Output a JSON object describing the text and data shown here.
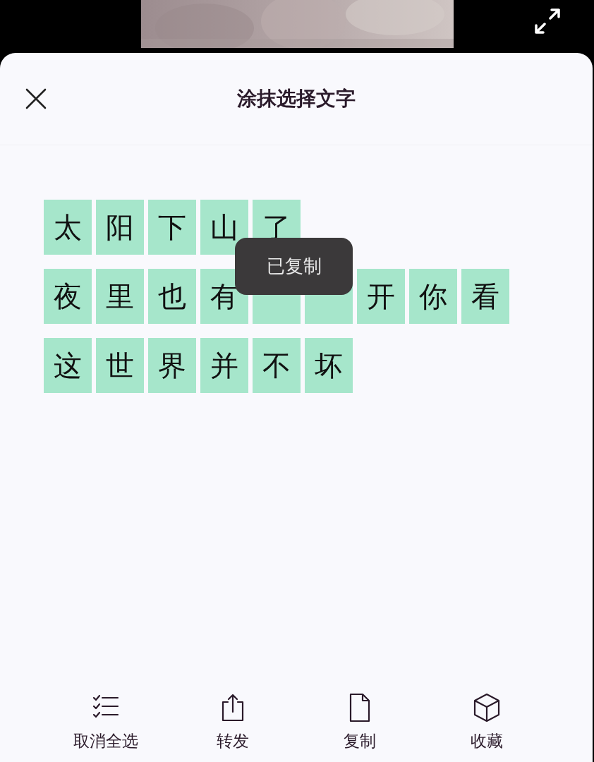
{
  "sheet": {
    "title": "涂抹选择文字"
  },
  "lines": [
    {
      "chars": [
        {
          "text": "太",
          "selected": true
        },
        {
          "text": "阳",
          "selected": true
        },
        {
          "text": "下",
          "selected": true
        },
        {
          "text": "山",
          "selected": true
        },
        {
          "text": "了",
          "selected": true
        }
      ]
    },
    {
      "chars": [
        {
          "text": "夜",
          "selected": true
        },
        {
          "text": "里",
          "selected": true
        },
        {
          "text": "也",
          "selected": true
        },
        {
          "text": "有",
          "selected": true
        },
        {
          "selected": true
        },
        {
          "selected": true
        },
        {
          "text": "开",
          "selected": true
        },
        {
          "text": "你",
          "selected": true
        },
        {
          "text": "看",
          "selected": true
        }
      ]
    },
    {
      "chars": [
        {
          "text": "这",
          "selected": true
        },
        {
          "text": "世",
          "selected": true
        },
        {
          "text": "界",
          "selected": true
        },
        {
          "text": "并",
          "selected": true
        },
        {
          "text": "不",
          "selected": true
        },
        {
          "text": "坏",
          "selected": true
        }
      ]
    }
  ],
  "toast": "已复制",
  "actions": [
    {
      "kind": "deselect",
      "label": "取消全选"
    },
    {
      "kind": "share",
      "label": "转发"
    },
    {
      "kind": "copy",
      "label": "复制"
    },
    {
      "kind": "save",
      "label": "收藏"
    }
  ]
}
